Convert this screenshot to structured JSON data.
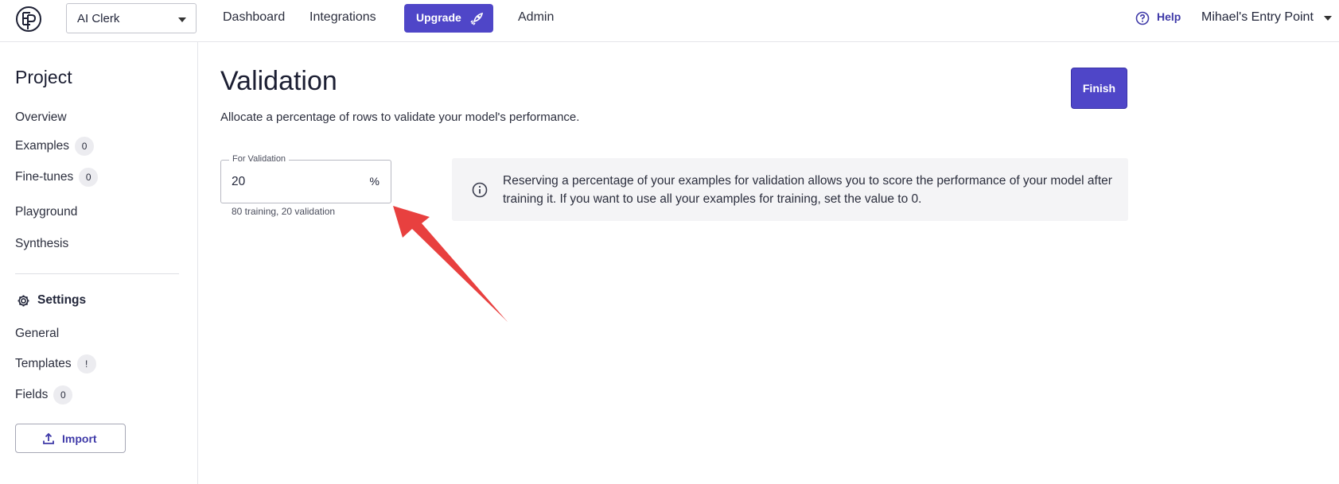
{
  "topbar": {
    "project_select": "AI Clerk",
    "nav": [
      "Dashboard",
      "Integrations",
      "Admin"
    ],
    "upgrade_label": "Upgrade",
    "help_label": "Help",
    "user_label": "Mihael's Entry Point",
    "icons": {
      "logo": "ep-logo",
      "upgrade": "rocket-icon",
      "help": "help-circle-icon"
    }
  },
  "sidebar": {
    "title": "Project",
    "items": [
      {
        "label": "Overview",
        "badge": ""
      },
      {
        "label": "Examples",
        "badge": "0"
      },
      {
        "label": "Fine-tunes",
        "badge": "0"
      },
      {
        "label": "Playground",
        "badge": ""
      },
      {
        "label": "Synthesis",
        "badge": ""
      }
    ],
    "settings_label": "Settings",
    "settings_items": [
      {
        "label": "General",
        "badge": ""
      },
      {
        "label": "Templates",
        "badge": "!"
      },
      {
        "label": "Fields",
        "badge": "0"
      }
    ],
    "import_label": "Import"
  },
  "main": {
    "title": "Validation",
    "description": "Allocate a percentage of rows to validate your model's performance.",
    "finish_label": "Finish",
    "field": {
      "label": "For Validation",
      "value": "20",
      "suffix": "%",
      "helper": "80 training, 20 validation"
    },
    "info_text": "Reserving a percentage of your examples for validation allows you to score the performance of your model after training it. If you want to use all your examples for training, set the value to 0."
  },
  "colors": {
    "primary": "#4f46c8",
    "annotation_arrow": "#e8403f",
    "info_bg": "#f4f4f6"
  }
}
